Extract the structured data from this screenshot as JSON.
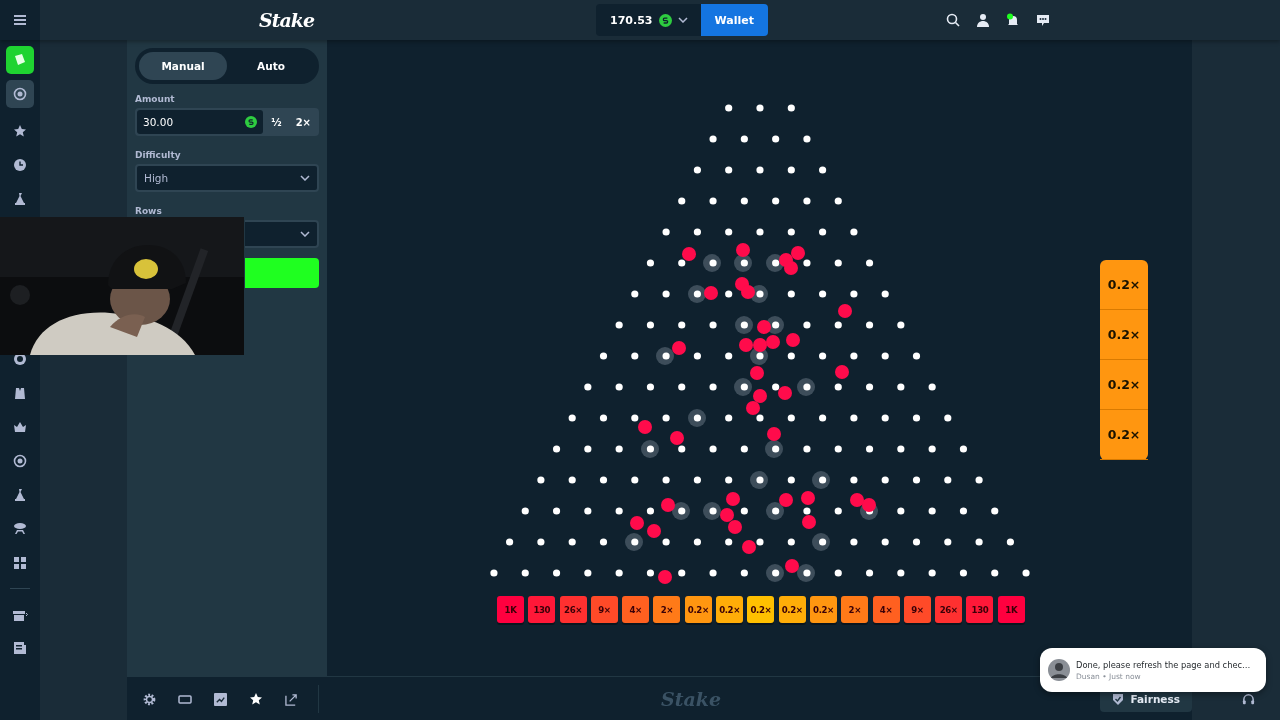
{
  "topbar": {
    "logo": "Stake",
    "balance": "170.53",
    "wallet_button": "Wallet"
  },
  "bet_panel": {
    "tabs": [
      {
        "label": "Manual",
        "selected": true
      },
      {
        "label": "Auto",
        "selected": false
      }
    ],
    "amount_label": "Amount",
    "amount_value": "30.00",
    "half_button": "½",
    "double_button": "2×",
    "difficulty_label": "Difficulty",
    "difficulty_value": "High",
    "rows_label": "Rows"
  },
  "multipliers": [
    {
      "label": "1K",
      "color": "#ff003f"
    },
    {
      "label": "130",
      "color": "#ff1838"
    },
    {
      "label": "26×",
      "color": "#ff3030"
    },
    {
      "label": "9×",
      "color": "#ff4a28"
    },
    {
      "label": "4×",
      "color": "#ff6020"
    },
    {
      "label": "2×",
      "color": "#ff7a18"
    },
    {
      "label": "0.2×",
      "color": "#ff9610"
    },
    {
      "label": "0.2×",
      "color": "#ffad08"
    },
    {
      "label": "0.2×",
      "color": "#ffc000"
    },
    {
      "label": "0.2×",
      "color": "#ffad08"
    },
    {
      "label": "0.2×",
      "color": "#ff9610"
    },
    {
      "label": "2×",
      "color": "#ff7a18"
    },
    {
      "label": "4×",
      "color": "#ff6020"
    },
    {
      "label": "9×",
      "color": "#ff4a28"
    },
    {
      "label": "26×",
      "color": "#ff3030"
    },
    {
      "label": "130",
      "color": "#ff1838"
    },
    {
      "label": "1K",
      "color": "#ff003f"
    }
  ],
  "recent_results": [
    "0.2×",
    "0.2×",
    "0.2×",
    "0.2×"
  ],
  "bottom_bar": {
    "watermark": "Stake",
    "fairness_button": "Fairness"
  },
  "toast": {
    "message": "Done, please refresh the page and chec…",
    "meta": "Dusan • Just now"
  }
}
